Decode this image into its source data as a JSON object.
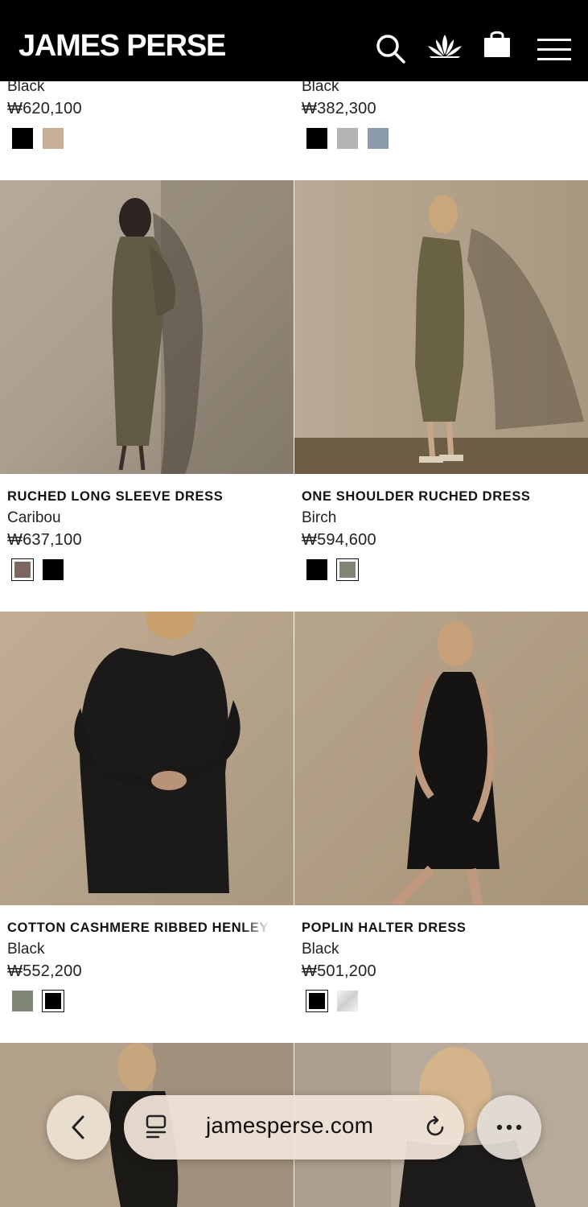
{
  "header": {
    "logo": "JAMES PERSE",
    "icons": [
      "search-icon",
      "lotus-icon",
      "shopping-bag-icon",
      "hamburger-menu-icon"
    ]
  },
  "partial_row": [
    {
      "color": "Black",
      "price": "₩620,100",
      "swatches": [
        "#000000",
        "#c8ae97"
      ]
    },
    {
      "color": "Black",
      "price": "₩382,300",
      "swatches": [
        "#000000",
        "#b3b3b3",
        "#8b9bab"
      ]
    }
  ],
  "products": [
    {
      "name": "RUCHED LONG SLEEVE DRESS",
      "color": "Caribou",
      "price": "₩637,100",
      "swatches": [
        "#7b6760",
        "#000000"
      ],
      "selected_swatch": 0
    },
    {
      "name": "ONE SHOULDER RUCHED DRESS",
      "color": "Birch",
      "price": "₩594,600",
      "swatches": [
        "#000000",
        "#7f8676"
      ],
      "selected_swatch": 1
    },
    {
      "name": "COTTON CASHMERE RIBBED HENLEY",
      "color": "Black",
      "price": "₩552,200",
      "swatches": [
        "#7f8676",
        "#000000"
      ],
      "selected_swatch": 1
    },
    {
      "name": "POPLIN HALTER DRESS",
      "color": "Black",
      "price": "₩501,200",
      "swatches": [
        "#000000",
        "#e2e2e2"
      ],
      "selected_swatch": 0
    }
  ],
  "browser": {
    "url": "jamesperse.com",
    "icons": [
      "back-chevron-icon",
      "reader-view-icon",
      "reload-icon",
      "more-icon"
    ]
  }
}
